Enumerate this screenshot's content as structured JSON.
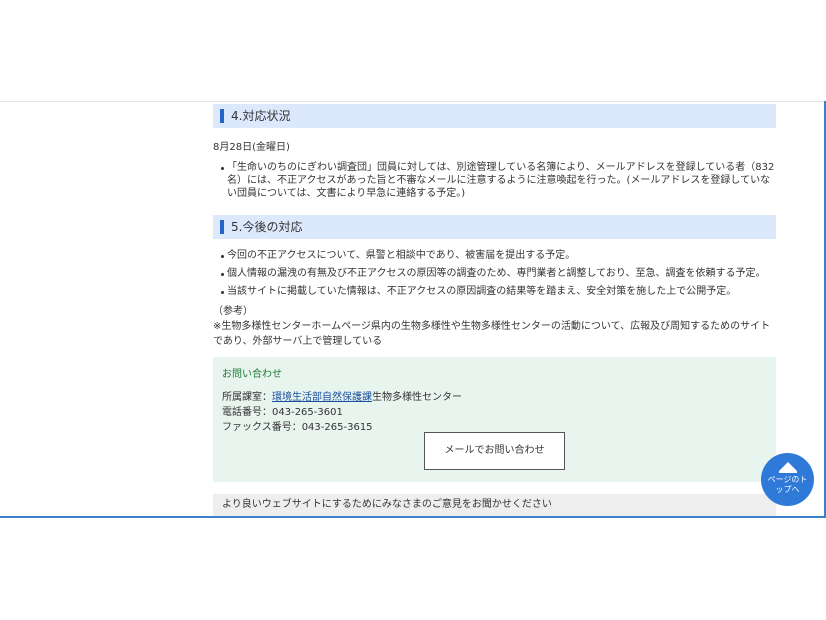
{
  "section4": {
    "heading": "4.対応状況",
    "date": "8月28日(金曜日)",
    "bullets": [
      "「生命いのちのにぎわい調査団」団員に対しては、別途管理している名簿により、メールアドレスを登録している者（832名）には、不正アクセスがあった旨と不審なメールに注意するように注意喚起を行った。(メールアドレスを登録していない団員については、文書により早急に連絡する予定。)"
    ]
  },
  "section5": {
    "heading": "5.今後の対応",
    "bullets": [
      "今回の不正アクセスについて、県警と相談中であり、被害届を提出する予定。",
      "個人情報の漏洩の有無及び不正アクセスの原因等の調査のため、専門業者と調整しており、至急、調査を依頼する予定。",
      "当該サイトに掲載していた情報は、不正アクセスの原因調査の結果等を踏まえ、安全対策を施した上で公開予定。"
    ]
  },
  "note": {
    "title": "（参考）",
    "text": "※生物多様性センターホームページ県内の生物多様性や生物多様性センターの活動について、広報及び周知するためのサイトであり、外部サーバ上で管理している"
  },
  "contact": {
    "title": "お問い合わせ",
    "dept_prefix": "所属課室：",
    "dept_link": "環境生活部自然保護課",
    "dept_suffix": "生物多様性センター",
    "phone": "電話番号：043-265-3601",
    "fax": "ファックス番号：043-265-3615",
    "mail_button": "メールでお問い合わせ"
  },
  "feedback": {
    "text": "より良いウェブサイトにするためにみなさまのご意見をお聞かせください"
  },
  "page_top": {
    "label": "ページのトップへ"
  },
  "colors": {
    "heading_bg": "#dce8fb",
    "heading_bar": "#2464c6",
    "contact_bg": "#e8f4ee",
    "contact_title": "#1e7c3a",
    "page_top_bg": "#2f7ad8"
  }
}
